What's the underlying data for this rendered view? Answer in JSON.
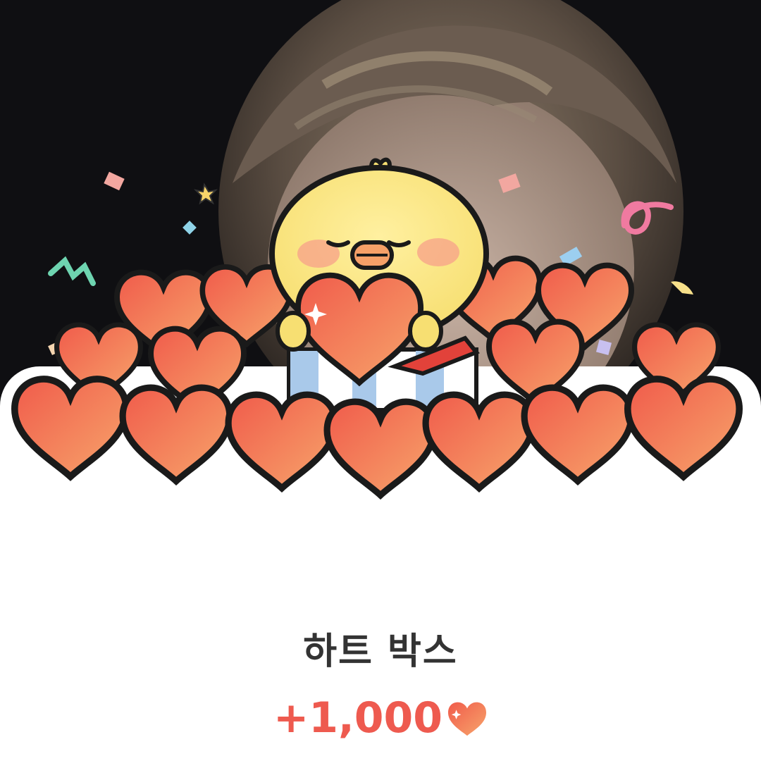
{
  "reward": {
    "title": "하트 박스",
    "amount": "+1,000",
    "icon": "heart-icon",
    "accent_color": "#ee5a4f"
  },
  "illustration": {
    "character": "yellow-chick-mascot",
    "items": "heart-pile",
    "decor": "confetti"
  }
}
